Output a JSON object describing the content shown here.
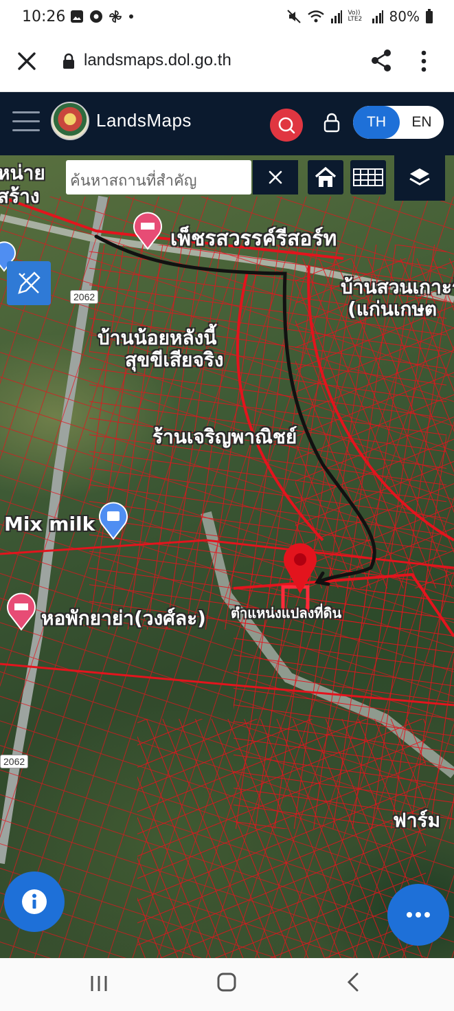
{
  "status_bar": {
    "time": "10:26",
    "battery": "80%",
    "left_icons": [
      "image-icon",
      "chrome-icon",
      "pinwheel-icon",
      "dot-icon"
    ],
    "right_icons": [
      "mute-icon",
      "wifi-icon",
      "signal-icon",
      "volte-icon",
      "signal-icon",
      "battery-icon"
    ],
    "volte_text": "Vo)) LTE2"
  },
  "browser": {
    "url": "landsmaps.dol.go.th"
  },
  "app": {
    "title": "LandsMaps",
    "lang_th": "TH",
    "lang_en": "EN"
  },
  "map": {
    "search_placeholder": "ค้นหาสถานที่สำคัญ",
    "labels": {
      "top_left": "หน่าย",
      "top_left_2": "สร้าง",
      "resort": "เพ็ชรสวรรค์รีสอร์ท",
      "village_top_right": "บ้านสวนเกาะรัก",
      "village_top_right_2": "(แก่นเกษต",
      "house_1": "บ้านน้อยหลังนี้",
      "house_2": "สุขขีเสียจริง",
      "shop": "ร้านเจริญพาณิชย์",
      "mix_milk": "Mix milk",
      "dorm": "หอพักยาย่า(วงศ์ละ)",
      "parcel": "ตำแหน่งแปลงที่ดิน",
      "farm": "ฟาร์ม"
    },
    "road_numbers": [
      "2062",
      "2062"
    ]
  },
  "colors": {
    "header_bg": "#0b1a2e",
    "accent_blue": "#1e70d8",
    "search_red": "#e03641",
    "parcel_red": "#e3141d"
  }
}
